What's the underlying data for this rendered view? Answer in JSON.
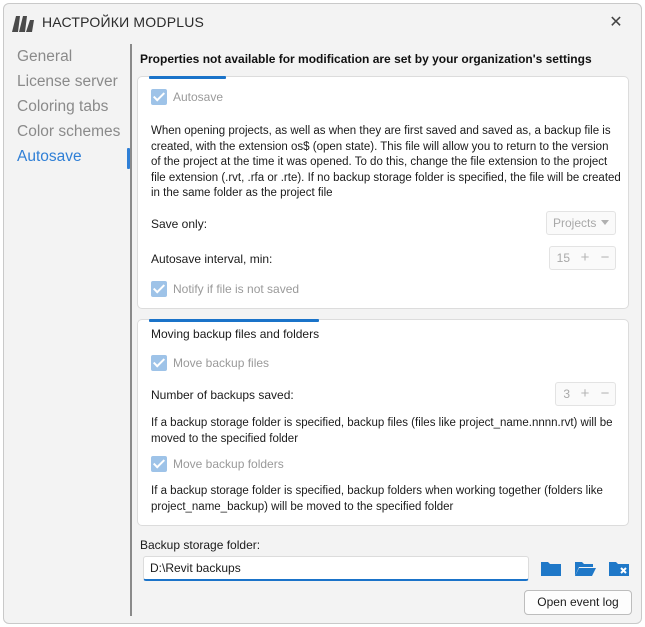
{
  "window": {
    "title": "НАСТРОЙКИ MODPLUS",
    "close_glyph": "✕"
  },
  "sidebar": {
    "items": [
      {
        "label": "General"
      },
      {
        "label": "License server"
      },
      {
        "label": "Coloring tabs"
      },
      {
        "label": "Color schemes"
      },
      {
        "label": "Autosave"
      }
    ],
    "active_index": 4
  },
  "main": {
    "header_note": "Properties not available for modification are set by your organization's settings",
    "autosave": {
      "checkbox_label": "Autosave",
      "checked": true,
      "description": "When opening projects, as well as when they are first saved and saved as, a backup file is created, with the extension os$ (open state). This file will allow you to return to the version of the project at the time it was opened. To do this, change the file extension to the project file extension (.rvt, .rfa or .rte). If no backup storage folder is specified, the file will be created in the same folder as the project file",
      "save_only_label": "Save only:",
      "save_only_value": "Projects",
      "interval_label": "Autosave interval, min:",
      "interval_value": "15",
      "notify_label": "Notify if file is not saved",
      "notify_checked": true
    },
    "backup": {
      "section_title": "Moving backup files and folders",
      "move_files_label": "Move backup files",
      "move_files_checked": true,
      "count_label": "Number of backups saved:",
      "count_value": "3",
      "files_note": "If a backup storage folder is specified, backup files (files like project_name.nnnn.rvt) will be moved to the specified folder",
      "move_folders_label": "Move backup folders",
      "move_folders_checked": true,
      "folders_note": "If a backup storage folder is specified, backup folders when working together (folders like project_name_backup) will be moved to the specified folder"
    },
    "storage": {
      "label": "Backup storage folder:",
      "value": "D:\\Revit backups"
    },
    "stepper_plus": "+",
    "stepper_minus": "−",
    "event_log_button": "Open event log"
  },
  "colors": {
    "accent": "#1a73c9",
    "sidebar_active": "#2f7fd6",
    "disabled_check": "#9ec3e8"
  },
  "icons": [
    "modplus-logo-icon",
    "close-icon",
    "check-icon",
    "folder-icon",
    "folder-open-icon",
    "folder-clear-icon"
  ]
}
